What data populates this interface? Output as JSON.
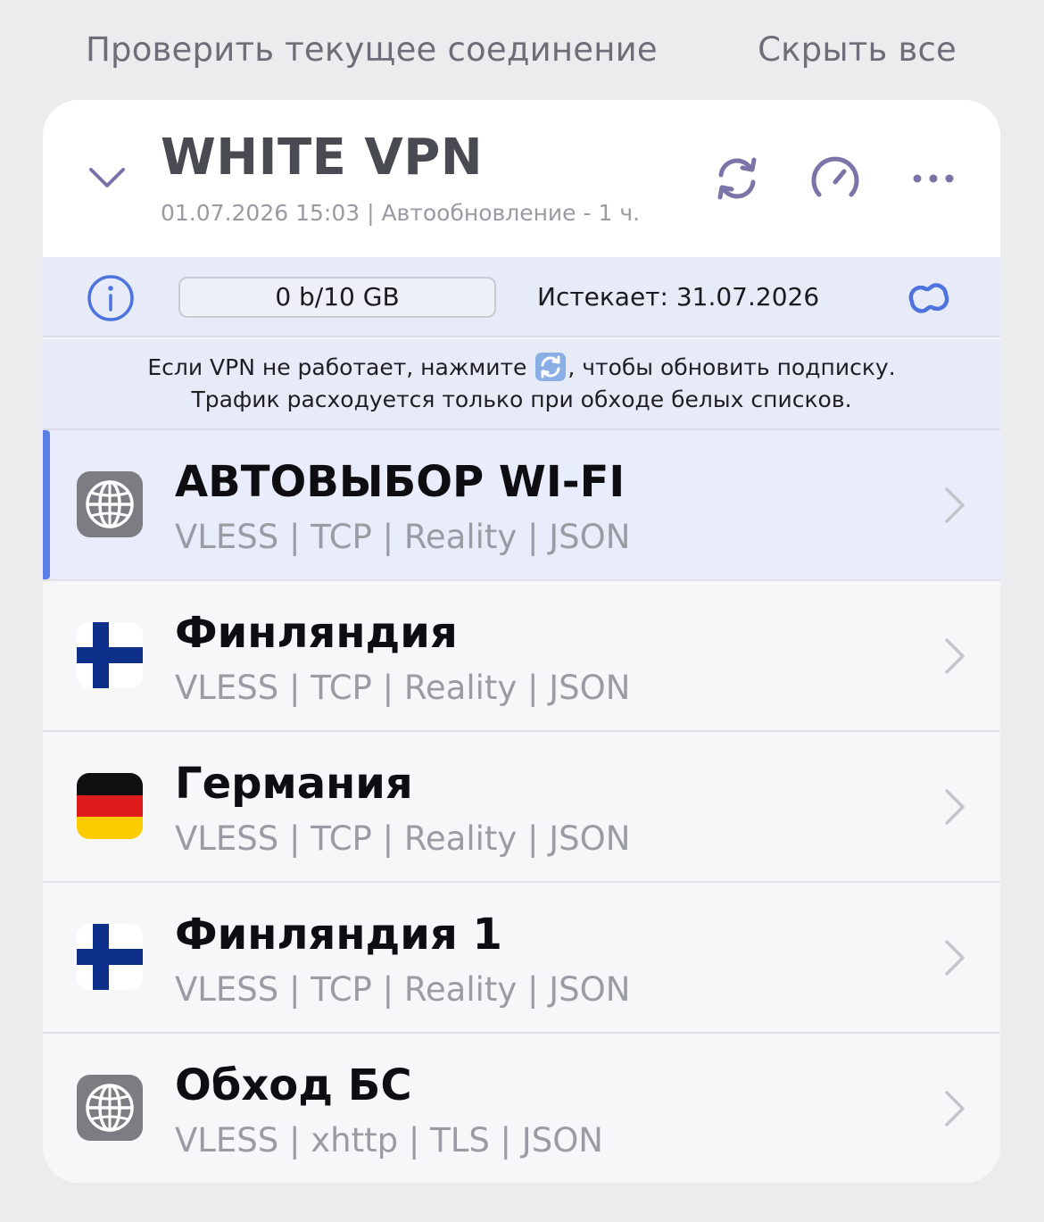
{
  "top": {
    "check_connection": "Проверить текущее соединение",
    "hide_all": "Скрыть все"
  },
  "subscription": {
    "title": "WHITE VPN",
    "updated": "01.07.2026 15:03 | Автообновление - 1 ч.",
    "traffic": "0 b/10 GB",
    "expires": "Истекает: 31.07.2026",
    "notice_part1": "Если VPN не работает, нажмите",
    "notice_part2": ", чтобы обновить подписку.",
    "notice_line2": "Трафик расходуется только при обходе белых списков."
  },
  "servers": [
    {
      "name": "АВТОВЫБОР WI-FI",
      "protocol": "VLESS | TCP | Reality | JSON",
      "icon": "globe-icon",
      "selected": true
    },
    {
      "name": "Финляндия",
      "protocol": "VLESS | TCP | Reality | JSON",
      "icon": "finland-flag-icon",
      "selected": false
    },
    {
      "name": "Германия",
      "protocol": "VLESS | TCP | Reality | JSON",
      "icon": "germany-flag-icon",
      "selected": false
    },
    {
      "name": "Финляндия 1",
      "protocol": "VLESS | TCP | Reality | JSON",
      "icon": "finland-flag-icon",
      "selected": false
    },
    {
      "name": "Обход БС",
      "protocol": "VLESS | xhttp | TLS | JSON",
      "icon": "globe-icon",
      "selected": false
    }
  ],
  "colors": {
    "accent": "#5b7fe6",
    "icon_purple": "#7b74a8",
    "info_blue": "#4c73de"
  }
}
